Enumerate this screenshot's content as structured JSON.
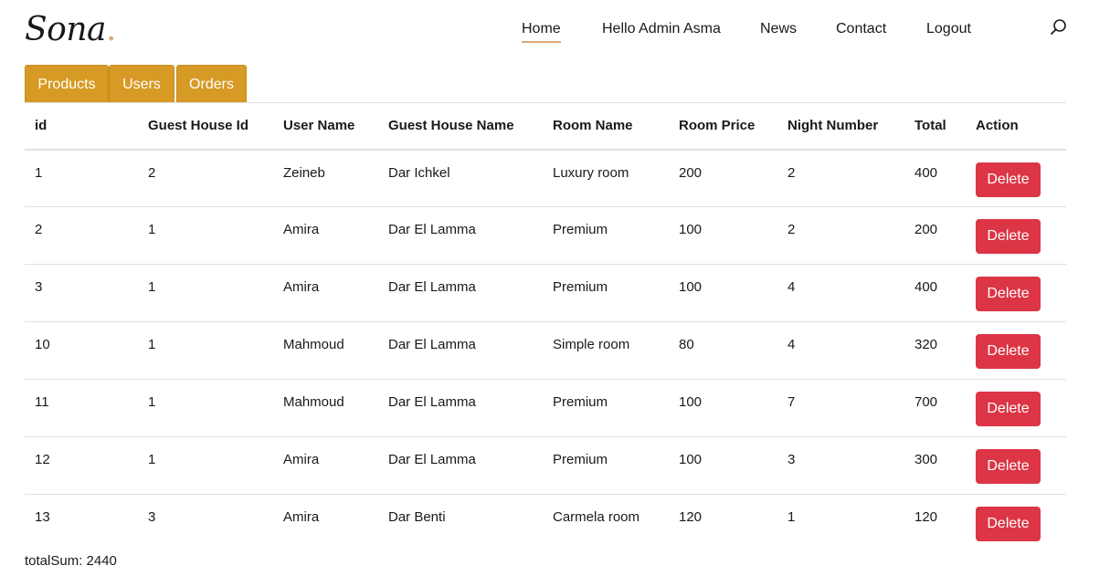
{
  "brand": {
    "name": "Sona",
    "dot": "."
  },
  "nav": {
    "items": [
      {
        "label": "Home",
        "active": true
      },
      {
        "label": "Hello Admin Asma",
        "active": false
      },
      {
        "label": "News",
        "active": false
      },
      {
        "label": "Contact",
        "active": false
      },
      {
        "label": "Logout",
        "active": false
      }
    ],
    "search_icon": "search-icon"
  },
  "tabs": [
    {
      "label": "Products"
    },
    {
      "label": "Users"
    },
    {
      "label": "Orders"
    }
  ],
  "table": {
    "headers": [
      "id",
      "Guest House Id",
      "User Name",
      "Guest House Name",
      "Room Name",
      "Room Price",
      "Night Number",
      "Total",
      "Action"
    ],
    "rows": [
      {
        "id": "1",
        "guest_house_id": "2",
        "user_name": "Zeineb",
        "guest_house_name": "Dar Ichkel",
        "room_name": "Luxury room",
        "room_price": "200",
        "night_number": "2",
        "total": "400",
        "action": "Delete"
      },
      {
        "id": "2",
        "guest_house_id": "1",
        "user_name": "Amira",
        "guest_house_name": "Dar El Lamma",
        "room_name": "Premium",
        "room_price": "100",
        "night_number": "2",
        "total": "200",
        "action": "Delete"
      },
      {
        "id": "3",
        "guest_house_id": "1",
        "user_name": "Amira",
        "guest_house_name": "Dar El Lamma",
        "room_name": "Premium",
        "room_price": "100",
        "night_number": "4",
        "total": "400",
        "action": "Delete"
      },
      {
        "id": "10",
        "guest_house_id": "1",
        "user_name": "Mahmoud",
        "guest_house_name": "Dar El Lamma",
        "room_name": "Simple room",
        "room_price": "80",
        "night_number": "4",
        "total": "320",
        "action": "Delete"
      },
      {
        "id": "11",
        "guest_house_id": "1",
        "user_name": "Mahmoud",
        "guest_house_name": "Dar El Lamma",
        "room_name": "Premium",
        "room_price": "100",
        "night_number": "7",
        "total": "700",
        "action": "Delete"
      },
      {
        "id": "12",
        "guest_house_id": "1",
        "user_name": "Amira",
        "guest_house_name": "Dar El Lamma",
        "room_name": "Premium",
        "room_price": "100",
        "night_number": "3",
        "total": "300",
        "action": "Delete"
      },
      {
        "id": "13",
        "guest_house_id": "3",
        "user_name": "Amira",
        "guest_house_name": "Dar Benti",
        "room_name": "Carmela room",
        "room_price": "120",
        "night_number": "1",
        "total": "120",
        "action": "Delete"
      }
    ]
  },
  "total_sum": "totalSum: 2440",
  "colors": {
    "tab_bg": "#d79a25",
    "delete_button": "#dc3545",
    "accent_underline": "#dfa974"
  }
}
